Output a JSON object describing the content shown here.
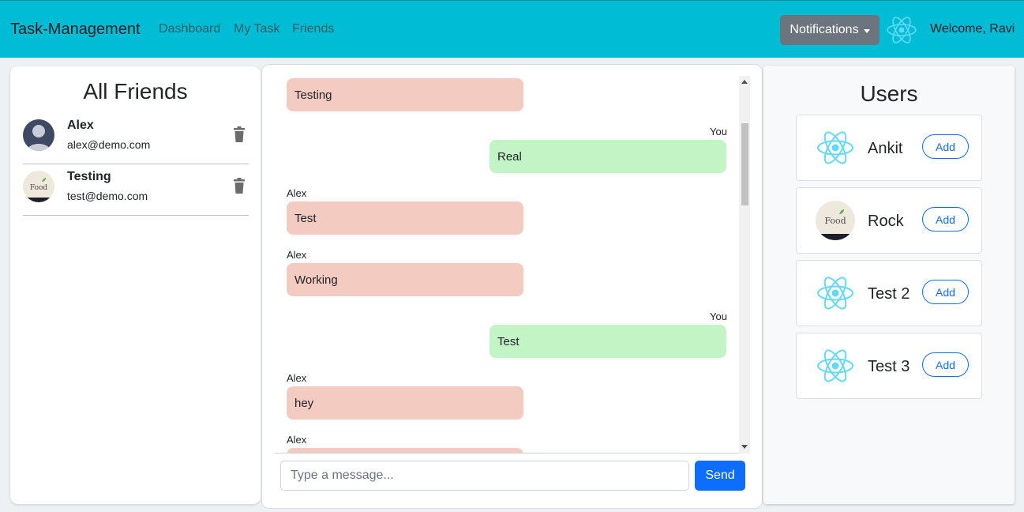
{
  "navbar": {
    "brand": "Task-Management",
    "links": [
      "Dashboard",
      "My Task",
      "Friends"
    ],
    "notifications_label": "Notifications",
    "welcome": "Welcome, Ravi"
  },
  "friends": {
    "title": "All Friends",
    "items": [
      {
        "name": "Alex",
        "email": "alex@demo.com",
        "avatar": "person-avatar"
      },
      {
        "name": "Testing",
        "email": "test@demo.com",
        "avatar": "food-logo-avatar"
      }
    ]
  },
  "chat": {
    "messages": [
      {
        "sender": "",
        "text": "Testing",
        "direction": "in"
      },
      {
        "sender": "You",
        "text": "Real",
        "direction": "out"
      },
      {
        "sender": "Alex",
        "text": "Test",
        "direction": "in"
      },
      {
        "sender": "Alex",
        "text": "Working",
        "direction": "in"
      },
      {
        "sender": "You",
        "text": "Test",
        "direction": "out"
      },
      {
        "sender": "Alex",
        "text": "hey",
        "direction": "in"
      },
      {
        "sender": "Alex",
        "text": "",
        "direction": "in"
      }
    ],
    "input_placeholder": "Type a message...",
    "send_label": "Send"
  },
  "users": {
    "title": "Users",
    "items": [
      {
        "name": "Ankit",
        "avatar": "react-logo",
        "add_label": "Add"
      },
      {
        "name": "Rock",
        "avatar": "food-logo",
        "add_label": "Add"
      },
      {
        "name": "Test 2",
        "avatar": "react-logo",
        "add_label": "Add"
      },
      {
        "name": "Test 3",
        "avatar": "react-logo",
        "add_label": "Add"
      }
    ]
  },
  "colors": {
    "navbar": "#00bcd4",
    "incoming_bubble": "#f4cbc0",
    "outgoing_bubble": "#c3f4c6",
    "primary": "#0d6efd",
    "secondary": "#6c757d"
  }
}
